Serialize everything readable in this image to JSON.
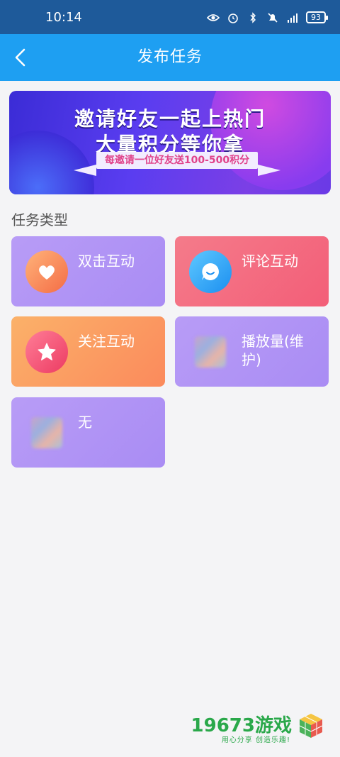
{
  "status": {
    "time": "10:14",
    "battery": "93"
  },
  "appbar": {
    "title": "发布任务"
  },
  "banner": {
    "line1": "邀请好友一起上热门",
    "line2": "大量积分等你拿",
    "ribbon": "每邀请一位好友送100-500积分"
  },
  "section": {
    "title": "任务类型"
  },
  "tasks": [
    {
      "label": "双击互动",
      "icon": "heart-icon"
    },
    {
      "label": "评论互动",
      "icon": "comment-icon"
    },
    {
      "label": "关注互动",
      "icon": "star-icon"
    },
    {
      "label": "播放量(维护)",
      "icon": "placeholder-image-icon"
    },
    {
      "label": "无",
      "icon": "placeholder-image-icon"
    }
  ],
  "watermark": {
    "brand": "19673游戏",
    "slogan": "用心分享 创造乐趣!"
  },
  "colors": {
    "statusbar": "#1e5a9a",
    "appbar": "#1e9ff2",
    "card_purple": "#b89cf6",
    "card_pink": "#f35e78",
    "card_orange": "#fb8a5c"
  }
}
